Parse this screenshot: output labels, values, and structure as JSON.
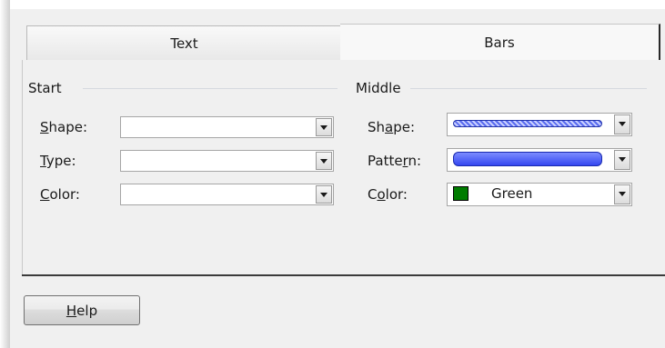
{
  "tabs": [
    {
      "label": "Text",
      "selected": false
    },
    {
      "label": "Bars",
      "selected": true
    }
  ],
  "start": {
    "title": "Start",
    "fields": [
      {
        "label_pre": "",
        "mnemonic": "S",
        "label_post": "hape:",
        "value": ""
      },
      {
        "label_pre": "",
        "mnemonic": "T",
        "label_post": "ype:",
        "value": ""
      },
      {
        "label_pre": "",
        "mnemonic": "C",
        "label_post": "olor:",
        "value": ""
      }
    ]
  },
  "middle": {
    "title": "Middle",
    "fields": [
      {
        "label_pre": "Sh",
        "mnemonic": "a",
        "label_post": "pe:",
        "swatch": "thin-hatched-bar"
      },
      {
        "label_pre": "Patte",
        "mnemonic": "r",
        "label_post": "n:",
        "swatch": "solid-blue-bar"
      },
      {
        "label_pre": "C",
        "mnemonic": "o",
        "label_post": "lor:",
        "value": "Green",
        "color": "#007c00"
      }
    ]
  },
  "help_button": {
    "mnemonic": "H",
    "label_post": "elp"
  },
  "colors": {
    "bar_fill": "#3447f0",
    "green": "#007c00"
  }
}
